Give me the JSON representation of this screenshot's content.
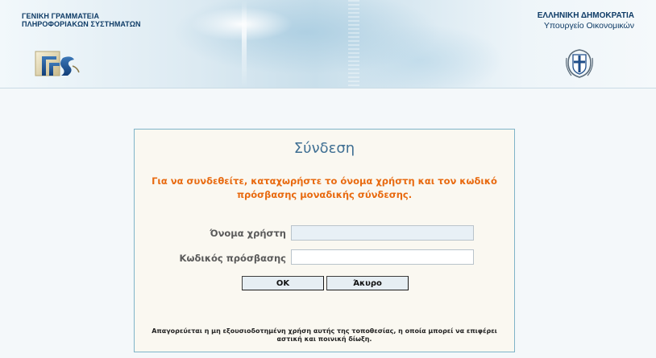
{
  "header": {
    "gsis_line1": "ΓΕΝΙΚΗ ΓΡΑΜΜΑΤΕΙΑ",
    "gsis_line2": "ΠΛΗΡΟΦΟΡΙΑΚΩΝ ΣΥΣΤΗΜΑΤΩΝ",
    "republic_line1": "ΕΛΛΗΝΙΚΗ ΔΗΜΟΚΡΑΤΙΑ",
    "republic_line2": "Υπουργείο Οικονομικών",
    "gsis_logo_icon": "gsis-logo-icon",
    "emblem_icon": "greek-coat-of-arms-icon"
  },
  "login": {
    "title": "Σύνδεση",
    "message": "Για να συνδεθείτε, καταχωρήστε το όνομα χρήστη και τον κωδικό πρόσβασης μοναδικής σύνδεσης.",
    "username_label": "Όνομα χρήστη",
    "username_value": "",
    "password_label": "Κωδικός πρόσβασης",
    "password_value": "",
    "ok_label": "OK",
    "cancel_label": "Άκυρο",
    "footer": "Απαγορεύεται η μη εξουσιοδοτημένη χρήση αυτής της τοποθεσίας, η οποία μπορεί να επιφέρει αστική και ποινική δίωξη."
  },
  "colors": {
    "title": "#3f6f93",
    "message": "#e86a10",
    "panel_border": "#7fb4c8",
    "panel_bg": "#faf8f1",
    "header_text": "#0e3b66"
  }
}
